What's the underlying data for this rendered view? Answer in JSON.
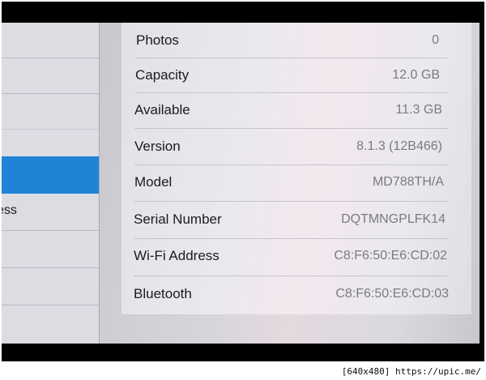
{
  "sidebar": {
    "items": [
      {
        "label": ""
      },
      {
        "label": ""
      },
      {
        "label": "",
        "selected": true
      },
      {
        "label": "ess"
      },
      {
        "label": ""
      },
      {
        "label": ""
      }
    ]
  },
  "about": {
    "rows": [
      {
        "label": "Photos",
        "value": "0"
      },
      {
        "label": "Capacity",
        "value": "12.0 GB"
      },
      {
        "label": "Available",
        "value": "11.3 GB"
      },
      {
        "label": "Version",
        "value": "8.1.3 (12B466)"
      },
      {
        "label": "Model",
        "value": "MD788TH/A"
      },
      {
        "label": "Serial Number",
        "value": "DQTMNGPLFK14"
      },
      {
        "label": "Wi-Fi Address",
        "value": "C8:F6:50:E6:CD:02"
      },
      {
        "label": "Bluetooth",
        "value": "C8:F6:50:E6:CD:03"
      }
    ]
  },
  "watermark": {
    "text": "[640x480] https://upic.me/"
  },
  "colors": {
    "selected_row": "#1f84d6",
    "value_text": "#7a7b82",
    "label_text": "#1b1b1f"
  }
}
